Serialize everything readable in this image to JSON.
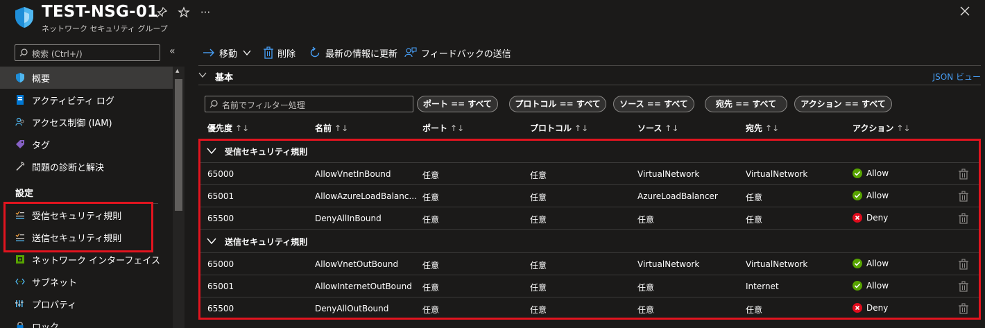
{
  "header": {
    "title": "TEST-NSG-01",
    "subtitle": "ネットワーク セキュリティ グループ"
  },
  "sidebar": {
    "search_placeholder": "検索 (Ctrl+/)",
    "items": [
      {
        "label": "概要",
        "icon": "shield-icon",
        "active": true
      },
      {
        "label": "アクティビティ ログ",
        "icon": "activity-log-icon"
      },
      {
        "label": "アクセス制御 (IAM)",
        "icon": "iam-icon"
      },
      {
        "label": "タグ",
        "icon": "tag-icon"
      },
      {
        "label": "問題の診断と解決",
        "icon": "wrench-icon"
      }
    ],
    "section_label": "設定",
    "settings_items": [
      {
        "label": "受信セキュリティ規則",
        "icon": "inbound-rules-icon"
      },
      {
        "label": "送信セキュリティ規則",
        "icon": "outbound-rules-icon"
      },
      {
        "label": "ネットワーク インターフェイス",
        "icon": "network-interface-icon"
      },
      {
        "label": "サブネット",
        "icon": "subnet-icon"
      },
      {
        "label": "プロパティ",
        "icon": "properties-icon"
      },
      {
        "label": "ロック",
        "icon": "lock-icon"
      }
    ]
  },
  "toolbar": {
    "move": "移動",
    "delete": "削除",
    "refresh": "最新の情報に更新",
    "feedback": "フィードバックの送信"
  },
  "essentials": {
    "label": "基本",
    "json_view": "JSON ビュー"
  },
  "filters": {
    "name_placeholder": "名前でフィルター処理",
    "pills": [
      "ポート == すべて",
      "プロトコル == すべて",
      "ソース == すべて",
      "宛先 == すべて",
      "アクション == すべて"
    ]
  },
  "table": {
    "columns": [
      "優先度",
      "名前",
      "ポート",
      "プロトコル",
      "ソース",
      "宛先",
      "アクション"
    ],
    "groups": [
      {
        "label": "受信セキュリティ規則",
        "rows": [
          {
            "priority": "65000",
            "name": "AllowVnetInBound",
            "port": "任意",
            "protocol": "任意",
            "source": "VirtualNetwork",
            "destination": "VirtualNetwork",
            "action": "Allow"
          },
          {
            "priority": "65001",
            "name": "AllowAzureLoadBalanc...",
            "port": "任意",
            "protocol": "任意",
            "source": "AzureLoadBalancer",
            "destination": "任意",
            "action": "Allow"
          },
          {
            "priority": "65500",
            "name": "DenyAllInBound",
            "port": "任意",
            "protocol": "任意",
            "source": "任意",
            "destination": "任意",
            "action": "Deny"
          }
        ]
      },
      {
        "label": "送信セキュリティ規則",
        "rows": [
          {
            "priority": "65000",
            "name": "AllowVnetOutBound",
            "port": "任意",
            "protocol": "任意",
            "source": "VirtualNetwork",
            "destination": "VirtualNetwork",
            "action": "Allow"
          },
          {
            "priority": "65001",
            "name": "AllowInternetOutBound",
            "port": "任意",
            "protocol": "任意",
            "source": "任意",
            "destination": "Internet",
            "action": "Allow"
          },
          {
            "priority": "65500",
            "name": "DenyAllOutBound",
            "port": "任意",
            "protocol": "任意",
            "source": "任意",
            "destination": "任意",
            "action": "Deny"
          }
        ]
      }
    ]
  },
  "colors": {
    "accent": "#479ef5",
    "allow": "#57a300",
    "deny": "#e00b1c",
    "highlight": "#e2141f"
  }
}
